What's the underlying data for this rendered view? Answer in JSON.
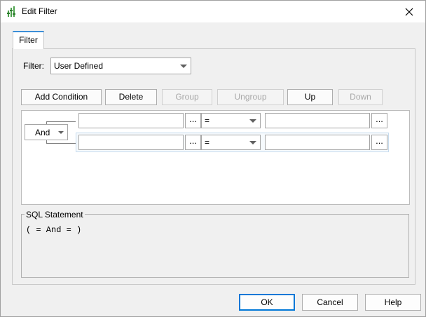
{
  "window": {
    "title": "Edit Filter"
  },
  "tabs": [
    {
      "label": "Filter"
    }
  ],
  "filter": {
    "label": "Filter:",
    "selected": "User Defined"
  },
  "toolbar": {
    "add_condition": "Add Condition",
    "delete": "Delete",
    "group": "Group",
    "ungroup": "Ungroup",
    "up": "Up",
    "down": "Down"
  },
  "conditions": {
    "logic_operator": "And",
    "rows": [
      {
        "field": "",
        "operator": "=",
        "value": "",
        "browse_label": "..."
      },
      {
        "field": "",
        "operator": "=",
        "value": "",
        "browse_label": "..."
      }
    ]
  },
  "sql": {
    "label": "SQL Statement",
    "text": "( = And = )"
  },
  "footer": {
    "ok": "OK",
    "cancel": "Cancel",
    "help": "Help"
  }
}
